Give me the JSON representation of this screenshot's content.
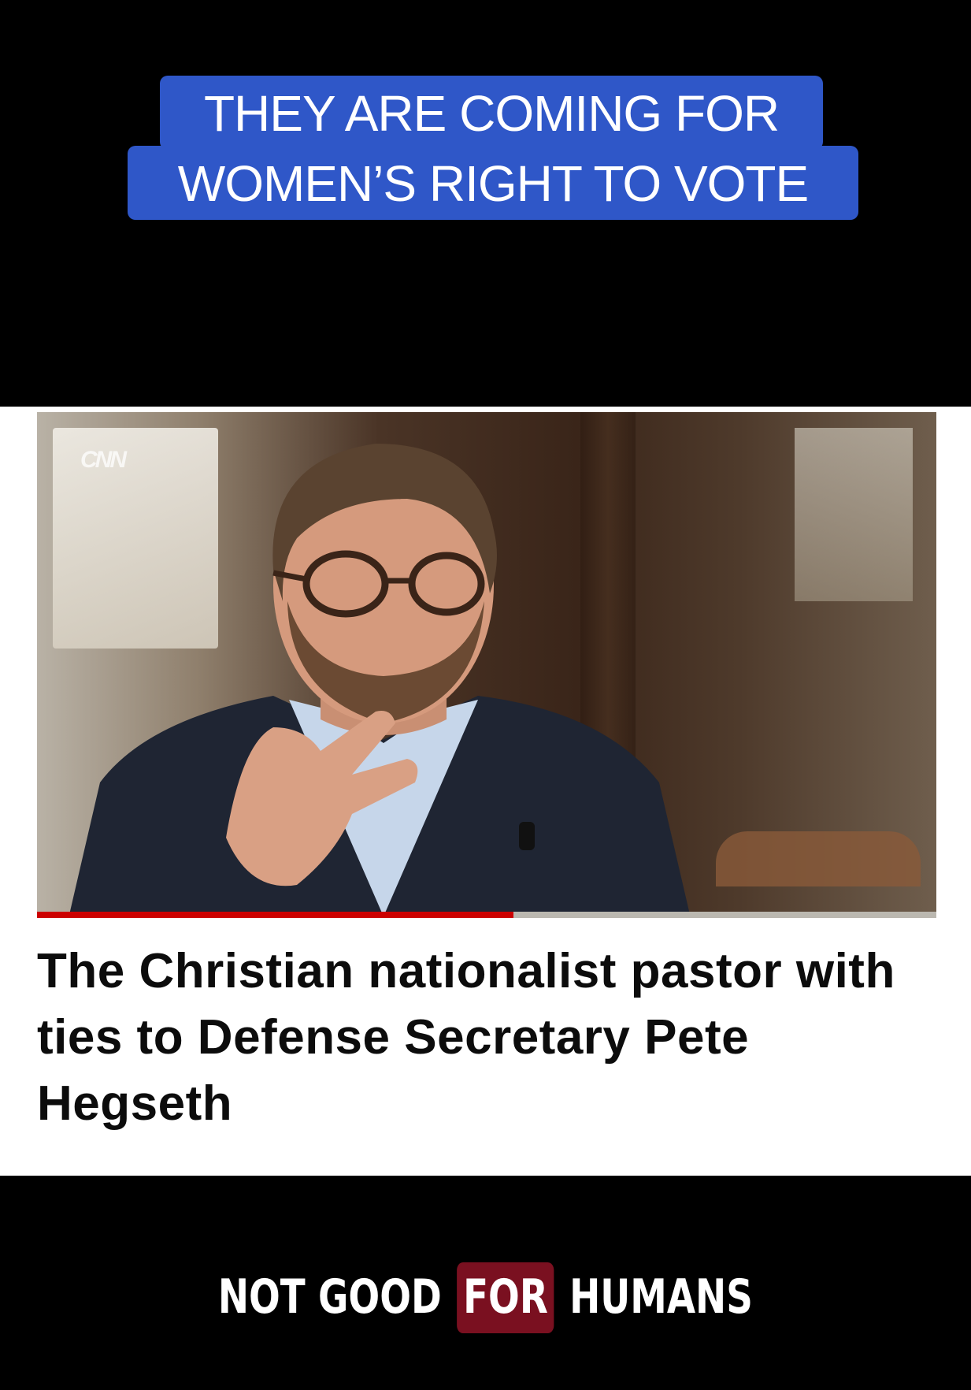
{
  "caption": {
    "line1": "THEY ARE COMING FOR",
    "line2": "WOMEN’S RIGHT TO VOTE"
  },
  "video": {
    "network_logo": "CNN",
    "progress_fraction": 0.53
  },
  "article": {
    "headline": "The Christian nationalist pastor with ties to Defense Secretary Pete Hegseth"
  },
  "brand": {
    "word1": "NOT GOOD",
    "highlighted": "FOR",
    "word2": "HUMANS"
  },
  "colors": {
    "caption_bg": "#2f57c8",
    "progress": "#cc0000",
    "brand_highlight": "#7a1020"
  }
}
